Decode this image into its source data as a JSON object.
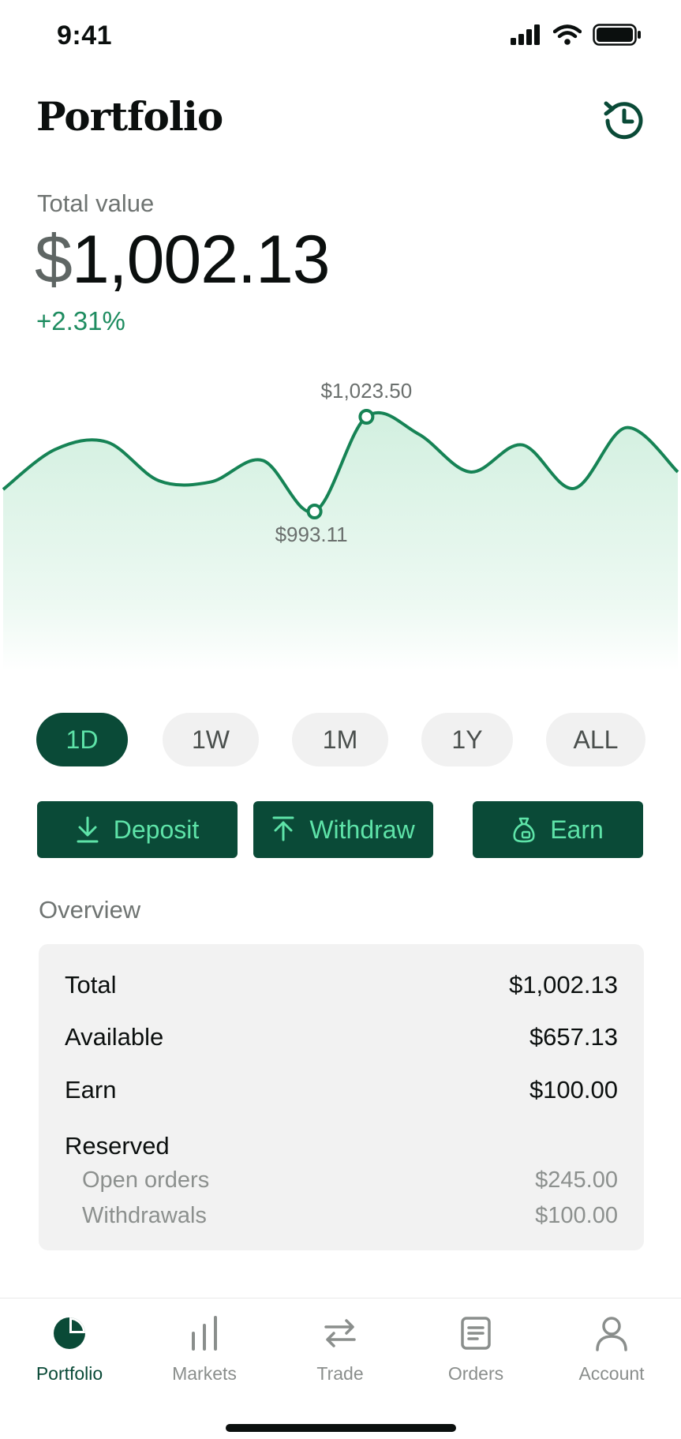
{
  "status": {
    "time": "9:41"
  },
  "header": {
    "title": "Portfolio",
    "history_icon": "history-clock-icon"
  },
  "balance": {
    "label": "Total value",
    "currency_symbol": "$",
    "amount": "1,002.13",
    "change": "+2.31%"
  },
  "chart_data": {
    "type": "line",
    "high_label": "$1,023.50",
    "low_label": "$993.11",
    "high": 1023.5,
    "low": 993.11,
    "points": [
      1000.2,
      1013.0,
      1015.4,
      1003.0,
      1002.6,
      1009.5,
      993.11,
      1023.5,
      1018.0,
      1005.8,
      1014.5,
      1000.5,
      1020.0,
      1005.8
    ],
    "line_color": "#168355",
    "fill_color": "#cdeedc"
  },
  "ranges": {
    "items": [
      "1D",
      "1W",
      "1M",
      "1Y",
      "ALL"
    ],
    "selected": "1D"
  },
  "actions": {
    "deposit": "Deposit",
    "withdraw": "Withdraw",
    "earn": "Earn"
  },
  "overview": {
    "title": "Overview",
    "total_label": "Total",
    "total_value": "$1,002.13",
    "available_label": "Available",
    "available_value": "$657.13",
    "earn_label": "Earn",
    "earn_value": "$100.00",
    "reserved_label": "Reserved",
    "open_orders_label": "Open orders",
    "open_orders_value": "$245.00",
    "withdrawals_label": "Withdrawals",
    "withdrawals_value": "$100.00"
  },
  "tabbar": {
    "portfolio": "Portfolio",
    "markets": "Markets",
    "trade": "Trade",
    "orders": "Orders",
    "account": "Account",
    "active": "Portfolio"
  },
  "colors": {
    "brand": "#0a4a37",
    "accent": "#5ee3a8",
    "positive": "#1e8c60"
  }
}
